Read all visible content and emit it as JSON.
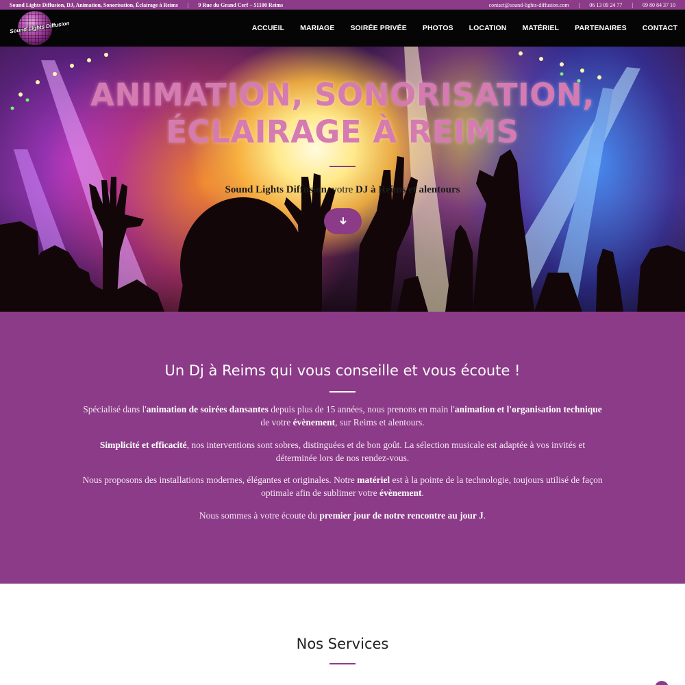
{
  "topbar": {
    "tagline": "Sound Lights Diffusion, DJ, Animation, Sonorisation, Éclairage à Reims",
    "address": "9 Rue du Grand Cerf – 51100 Reims",
    "email": "contact@sound-lights-diffusion.com",
    "phone1": "06 13 09 24 77",
    "phone2": "09 80 84 37 10",
    "separator": "|"
  },
  "logo": {
    "text": "Sound Lights Diffusion"
  },
  "nav": {
    "items": [
      "ACCUEIL",
      "MARIAGE",
      "SOIRÉE PRIVÉE",
      "PHOTOS",
      "LOCATION",
      "MATÉRIEL",
      "PARTENAIRES",
      "CONTACT"
    ]
  },
  "hero": {
    "title_line1": "ANIMATION, SONORISATION,",
    "title_line2": "ÉCLAIRAGE À REIMS",
    "subtitle_brand": "Sound Lights Diffusion",
    "subtitle_middle": ", votre ",
    "subtitle_strong": "DJ à Reims et alentours",
    "scroll_button_icon": "arrow-down-icon"
  },
  "about": {
    "heading": "Un Dj à Reims qui vous conseille et vous écoute !",
    "p1": {
      "a": "Spécialisé dans l'",
      "b": "animation de soirées dansantes",
      "c": " depuis plus de 15 années, nous prenons en main l'",
      "d": "animation et l'organisation technique",
      "e": " de votre ",
      "f": "évènement",
      "g": ", sur Reims et alentours."
    },
    "p2": {
      "a": "Simplicité et efficacité",
      "b": ", nos interventions sont sobres, distinguées et de bon goût. La sélection musicale est adaptée à vos invités et déterminée lors de nos rendez-vous."
    },
    "p3": {
      "a": "Nous proposons des installations modernes, élégantes et originales. Notre ",
      "b": "matériel",
      "c": " est à la pointe de la technologie, toujours utilisé de façon optimale afin de sublimer votre ",
      "d": "évènement",
      "e": "."
    },
    "p4": {
      "a": "Nous sommes à votre écoute du ",
      "b": "premier jour de notre rencontre au jour J",
      "c": "."
    }
  },
  "services": {
    "heading": "Nos Services"
  },
  "colors": {
    "brand_purple": "#8c3b88",
    "title_pink": "#d67ab2",
    "navbar_black": "#050505"
  }
}
